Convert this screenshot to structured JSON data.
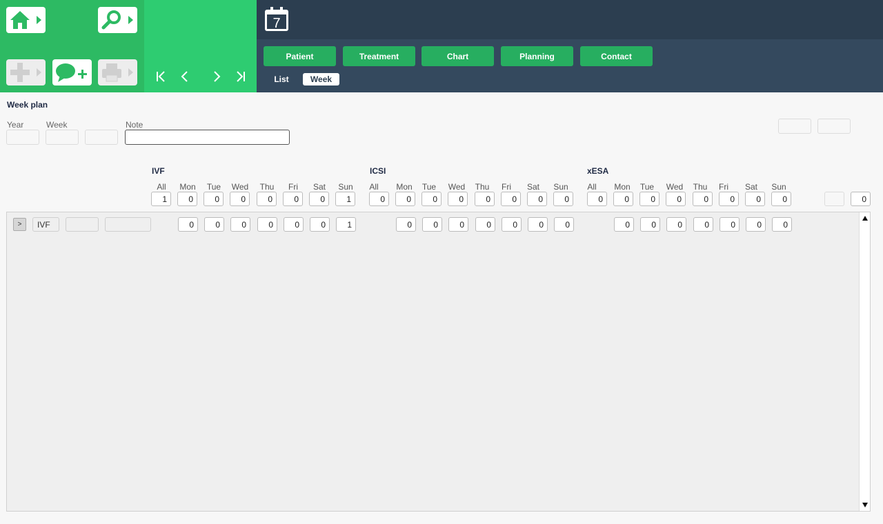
{
  "toolbar": {
    "nav": {
      "first": "first-page",
      "prev": "previous",
      "next": "next",
      "last": "last-page"
    }
  },
  "header": {
    "calendar_day": "7",
    "tabs": [
      {
        "label": "Patient"
      },
      {
        "label": "Treatment"
      },
      {
        "label": "Chart"
      },
      {
        "label": "Planning"
      },
      {
        "label": "Contact"
      }
    ],
    "subtabs": [
      {
        "label": "List",
        "active": false
      },
      {
        "label": "Week",
        "active": true
      }
    ]
  },
  "form": {
    "title": "Week plan",
    "year_label": "Year",
    "week_label": "Week",
    "note_label": "Note",
    "year_value": "",
    "week_value": "",
    "note_value": ""
  },
  "groups": [
    {
      "name": "IVF",
      "days": [
        "All",
        "Mon",
        "Tue",
        "Wed",
        "Thu",
        "Fri",
        "Sat",
        "Sun"
      ],
      "totals": [
        "1",
        "0",
        "0",
        "0",
        "0",
        "0",
        "0",
        "1"
      ]
    },
    {
      "name": "ICSI",
      "days": [
        "All",
        "Mon",
        "Tue",
        "Wed",
        "Thu",
        "Fri",
        "Sat",
        "Sun"
      ],
      "totals": [
        "0",
        "0",
        "0",
        "0",
        "0",
        "0",
        "0",
        "0"
      ]
    },
    {
      "name": "xESA",
      "days": [
        "All",
        "Mon",
        "Tue",
        "Wed",
        "Thu",
        "Fri",
        "Sat",
        "Sun"
      ],
      "totals": [
        "0",
        "0",
        "0",
        "0",
        "0",
        "0",
        "0",
        "0"
      ]
    }
  ],
  "extra_total": "0",
  "rows": [
    {
      "expand": ">",
      "type": "IVF",
      "ivf": [
        "0",
        "0",
        "0",
        "0",
        "0",
        "0",
        "1"
      ],
      "icsi": [
        "0",
        "0",
        "0",
        "0",
        "0",
        "0",
        "0"
      ],
      "xesa": [
        "0",
        "0",
        "0",
        "0",
        "0",
        "0",
        "0"
      ]
    }
  ],
  "colors": {
    "green": "#2ecc71",
    "dark_green": "#27ae60",
    "navy": "#2c3e50"
  }
}
